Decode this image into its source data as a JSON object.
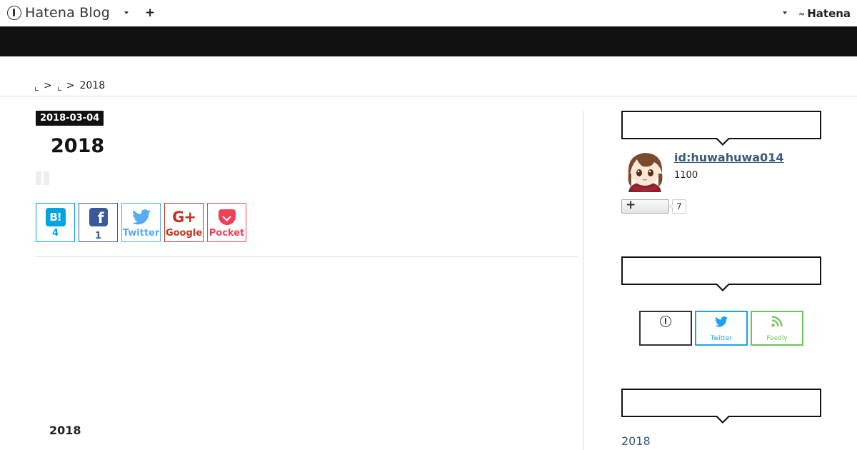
{
  "globalbar": {
    "logo_text": "Hatena Blog",
    "logo_icon": "hatena-blog-logo-icon",
    "dropdown_icon": "caret-down-icon",
    "add_icon": "plus-icon",
    "add_label": "+",
    "account_dropdown_icon": "caret-down-icon",
    "hatena_logo_text": "Hatena",
    "hatena_logo_icon": "hatena-bird-icon"
  },
  "header": {
    "background_color": "#111111"
  },
  "breadcrumb": {
    "separator": ">",
    "current": "2018"
  },
  "entry": {
    "date": "2018-03-04",
    "title": "2018",
    "share_buttons": [
      {
        "service": "hatena-bookmark",
        "icon": "hatena-bookmark-icon",
        "icon_text": "B!",
        "label": "4",
        "color": "#00a4de"
      },
      {
        "service": "facebook",
        "icon": "facebook-icon",
        "icon_text": "f",
        "label": "1",
        "color": "#3b5998"
      },
      {
        "service": "twitter",
        "icon": "twitter-icon",
        "label": "Twitter",
        "color": "#55acee"
      },
      {
        "service": "google-plus",
        "icon": "google-plus-icon",
        "icon_text": "G+",
        "label": "Google",
        "color": "#c23321"
      },
      {
        "service": "pocket",
        "icon": "pocket-icon",
        "label": "Pocket",
        "color": "#ee4056"
      }
    ]
  },
  "archive_heading": "2018",
  "sidebar": {
    "profile": {
      "id": "id:huwahuwa014",
      "count": "1100",
      "follow_icon": "plus-icon",
      "follower_count": "7"
    },
    "subscribe": [
      {
        "service": "hatena",
        "icon": "hatena-icon",
        "label": "",
        "color": "#333333"
      },
      {
        "service": "twitter",
        "icon": "twitter-icon",
        "label": "Twitter",
        "color": "#1da1f2"
      },
      {
        "service": "feedly",
        "icon": "rss-feed-icon",
        "label": "Feedly",
        "color": "#6cc655"
      }
    ],
    "archive_link": "2018"
  }
}
